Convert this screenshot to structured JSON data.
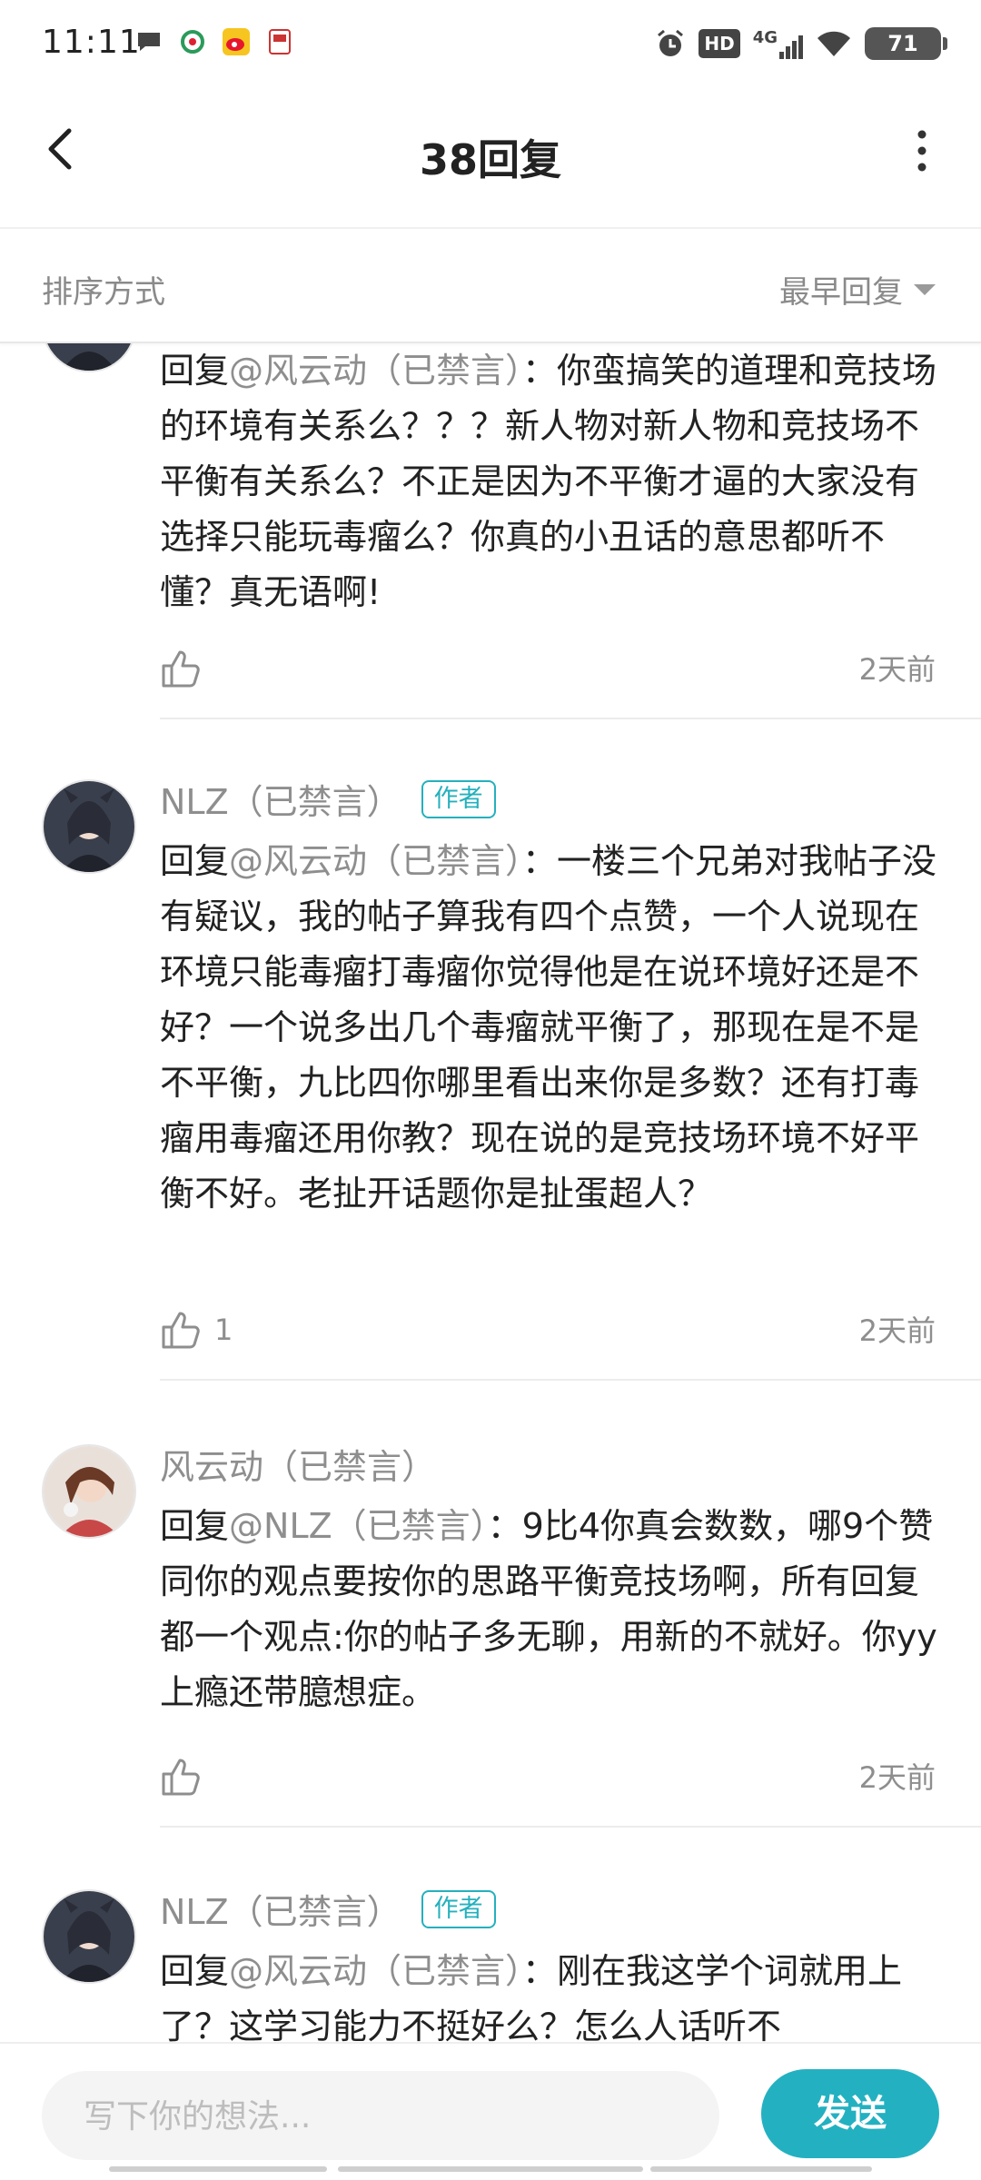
{
  "status": {
    "time": "11:11",
    "hd": "HD",
    "net": "4G",
    "battery": "71"
  },
  "header": {
    "title": "38回复"
  },
  "sort": {
    "label": "排序方式",
    "selected": "最早回复"
  },
  "comments": [
    {
      "reply_prefix": "回复",
      "mention": "@风云动（已禁言）",
      "text": "：你蛮搞笑的道理和竞技场的环境有关系么？？？新人物对新人物和竞技场不平衡有关系么？不正是因为不平衡才逼的大家没有选择只能玩毒瘤么？你真的小丑话的意思都听不懂？真无语啊!",
      "likes": "",
      "time": "2天前"
    },
    {
      "username": "NLZ（已禁言）",
      "badge": "作者",
      "reply_prefix": "回复",
      "mention": "@风云动（已禁言）",
      "text": "：一楼三个兄弟对我帖子没有疑议，我的帖子算我有四个点赞，一个人说现在环境只能毒瘤打毒瘤你觉得他是在说环境好还是不好？一个说多出几个毒瘤就平衡了，那现在是不是不平衡，九比四你哪里看出来你是多数？还有打毒瘤用毒瘤还用你教？现在说的是竞技场环境不好平衡不好。老扯开话题你是扯蛋超人？",
      "likes": "1",
      "time": "2天前"
    },
    {
      "username": "风云动（已禁言）",
      "reply_prefix": "回复",
      "mention": "@NLZ（已禁言）",
      "text": "：9比4你真会数数，哪9个赞同你的观点要按你的思路平衡竞技场啊，所有回复都一个观点:你的帖子多无聊，用新的不就好。你yy上瘾还带臆想症。",
      "likes": "",
      "time": "2天前"
    },
    {
      "username": "NLZ（已禁言）",
      "badge": "作者",
      "reply_prefix": "回复",
      "mention": "@风云动（已禁言）",
      "text": "：刚在我这学个词就用上了？这学习能力不挺好么？怎么人话听不"
    }
  ],
  "composer": {
    "placeholder": "写下你的想法...",
    "send_label": "发送"
  },
  "colors": {
    "accent": "#23b1c1",
    "muted_text": "#8e8e8e"
  }
}
